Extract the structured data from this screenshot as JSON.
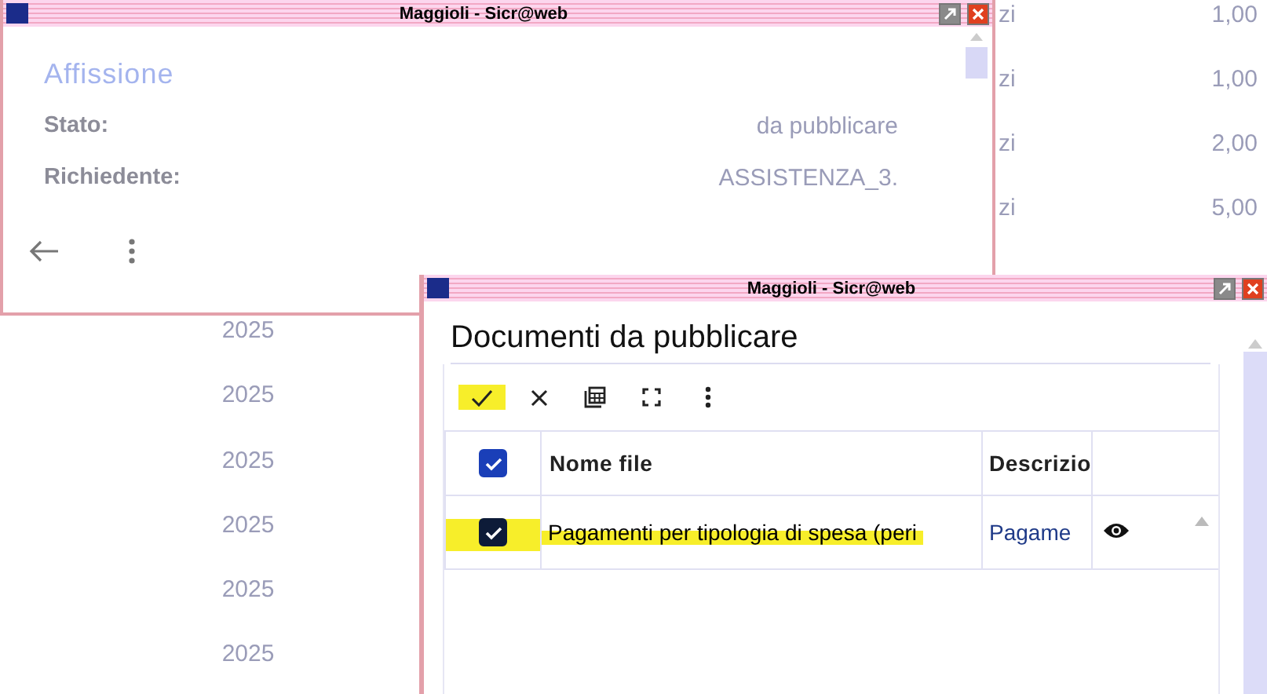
{
  "background_table": {
    "left_column": [
      "2025",
      "2025",
      "2025",
      "2025",
      "2025",
      "2025"
    ],
    "right_rows": [
      {
        "column_1": "zi",
        "column_2": "1,00"
      },
      {
        "column_1": "zi",
        "column_2": "1,00"
      },
      {
        "column_1": "zi",
        "column_2": "2,00"
      },
      {
        "column_1": "zi",
        "column_2": "5,00"
      }
    ]
  },
  "detail_window": {
    "title": "Maggioli - Sicr@web",
    "heading": "Affissione",
    "fields": [
      {
        "label": "Stato:",
        "value": "da pubblicare"
      },
      {
        "label": "Richiedente:",
        "value": "ASSISTENZA_3."
      }
    ]
  },
  "documents_window": {
    "title": "Maggioli - Sicr@web",
    "heading": "Documenti da pubblicare",
    "toolbar": [
      {
        "kind": "confirm",
        "highlighted": true
      },
      {
        "kind": "cancel",
        "highlighted": false
      },
      {
        "kind": "table",
        "highlighted": false
      },
      {
        "kind": "fullscreen",
        "highlighted": false
      },
      {
        "kind": "more",
        "highlighted": false
      }
    ],
    "table": {
      "all_checked": true,
      "columns": [
        "Nome file",
        "Descrizio"
      ],
      "rows": [
        {
          "checked": true,
          "highlighted": true,
          "cells": [
            "Pagamenti per tipologia di spesa (peri",
            "Pagame"
          ]
        }
      ]
    }
  }
}
